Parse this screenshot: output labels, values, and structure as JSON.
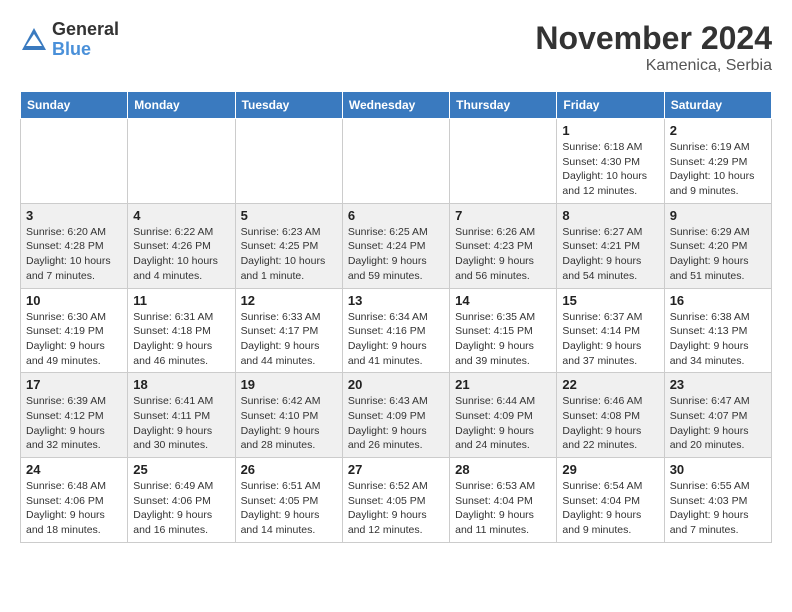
{
  "header": {
    "logo_line1": "General",
    "logo_line2": "Blue",
    "month": "November 2024",
    "location": "Kamenica, Serbia"
  },
  "weekdays": [
    "Sunday",
    "Monday",
    "Tuesday",
    "Wednesday",
    "Thursday",
    "Friday",
    "Saturday"
  ],
  "weeks": [
    [
      {
        "day": "",
        "info": ""
      },
      {
        "day": "",
        "info": ""
      },
      {
        "day": "",
        "info": ""
      },
      {
        "day": "",
        "info": ""
      },
      {
        "day": "",
        "info": ""
      },
      {
        "day": "1",
        "info": "Sunrise: 6:18 AM\nSunset: 4:30 PM\nDaylight: 10 hours and 12 minutes."
      },
      {
        "day": "2",
        "info": "Sunrise: 6:19 AM\nSunset: 4:29 PM\nDaylight: 10 hours and 9 minutes."
      }
    ],
    [
      {
        "day": "3",
        "info": "Sunrise: 6:20 AM\nSunset: 4:28 PM\nDaylight: 10 hours and 7 minutes."
      },
      {
        "day": "4",
        "info": "Sunrise: 6:22 AM\nSunset: 4:26 PM\nDaylight: 10 hours and 4 minutes."
      },
      {
        "day": "5",
        "info": "Sunrise: 6:23 AM\nSunset: 4:25 PM\nDaylight: 10 hours and 1 minute."
      },
      {
        "day": "6",
        "info": "Sunrise: 6:25 AM\nSunset: 4:24 PM\nDaylight: 9 hours and 59 minutes."
      },
      {
        "day": "7",
        "info": "Sunrise: 6:26 AM\nSunset: 4:23 PM\nDaylight: 9 hours and 56 minutes."
      },
      {
        "day": "8",
        "info": "Sunrise: 6:27 AM\nSunset: 4:21 PM\nDaylight: 9 hours and 54 minutes."
      },
      {
        "day": "9",
        "info": "Sunrise: 6:29 AM\nSunset: 4:20 PM\nDaylight: 9 hours and 51 minutes."
      }
    ],
    [
      {
        "day": "10",
        "info": "Sunrise: 6:30 AM\nSunset: 4:19 PM\nDaylight: 9 hours and 49 minutes."
      },
      {
        "day": "11",
        "info": "Sunrise: 6:31 AM\nSunset: 4:18 PM\nDaylight: 9 hours and 46 minutes."
      },
      {
        "day": "12",
        "info": "Sunrise: 6:33 AM\nSunset: 4:17 PM\nDaylight: 9 hours and 44 minutes."
      },
      {
        "day": "13",
        "info": "Sunrise: 6:34 AM\nSunset: 4:16 PM\nDaylight: 9 hours and 41 minutes."
      },
      {
        "day": "14",
        "info": "Sunrise: 6:35 AM\nSunset: 4:15 PM\nDaylight: 9 hours and 39 minutes."
      },
      {
        "day": "15",
        "info": "Sunrise: 6:37 AM\nSunset: 4:14 PM\nDaylight: 9 hours and 37 minutes."
      },
      {
        "day": "16",
        "info": "Sunrise: 6:38 AM\nSunset: 4:13 PM\nDaylight: 9 hours and 34 minutes."
      }
    ],
    [
      {
        "day": "17",
        "info": "Sunrise: 6:39 AM\nSunset: 4:12 PM\nDaylight: 9 hours and 32 minutes."
      },
      {
        "day": "18",
        "info": "Sunrise: 6:41 AM\nSunset: 4:11 PM\nDaylight: 9 hours and 30 minutes."
      },
      {
        "day": "19",
        "info": "Sunrise: 6:42 AM\nSunset: 4:10 PM\nDaylight: 9 hours and 28 minutes."
      },
      {
        "day": "20",
        "info": "Sunrise: 6:43 AM\nSunset: 4:09 PM\nDaylight: 9 hours and 26 minutes."
      },
      {
        "day": "21",
        "info": "Sunrise: 6:44 AM\nSunset: 4:09 PM\nDaylight: 9 hours and 24 minutes."
      },
      {
        "day": "22",
        "info": "Sunrise: 6:46 AM\nSunset: 4:08 PM\nDaylight: 9 hours and 22 minutes."
      },
      {
        "day": "23",
        "info": "Sunrise: 6:47 AM\nSunset: 4:07 PM\nDaylight: 9 hours and 20 minutes."
      }
    ],
    [
      {
        "day": "24",
        "info": "Sunrise: 6:48 AM\nSunset: 4:06 PM\nDaylight: 9 hours and 18 minutes."
      },
      {
        "day": "25",
        "info": "Sunrise: 6:49 AM\nSunset: 4:06 PM\nDaylight: 9 hours and 16 minutes."
      },
      {
        "day": "26",
        "info": "Sunrise: 6:51 AM\nSunset: 4:05 PM\nDaylight: 9 hours and 14 minutes."
      },
      {
        "day": "27",
        "info": "Sunrise: 6:52 AM\nSunset: 4:05 PM\nDaylight: 9 hours and 12 minutes."
      },
      {
        "day": "28",
        "info": "Sunrise: 6:53 AM\nSunset: 4:04 PM\nDaylight: 9 hours and 11 minutes."
      },
      {
        "day": "29",
        "info": "Sunrise: 6:54 AM\nSunset: 4:04 PM\nDaylight: 9 hours and 9 minutes."
      },
      {
        "day": "30",
        "info": "Sunrise: 6:55 AM\nSunset: 4:03 PM\nDaylight: 9 hours and 7 minutes."
      }
    ]
  ]
}
